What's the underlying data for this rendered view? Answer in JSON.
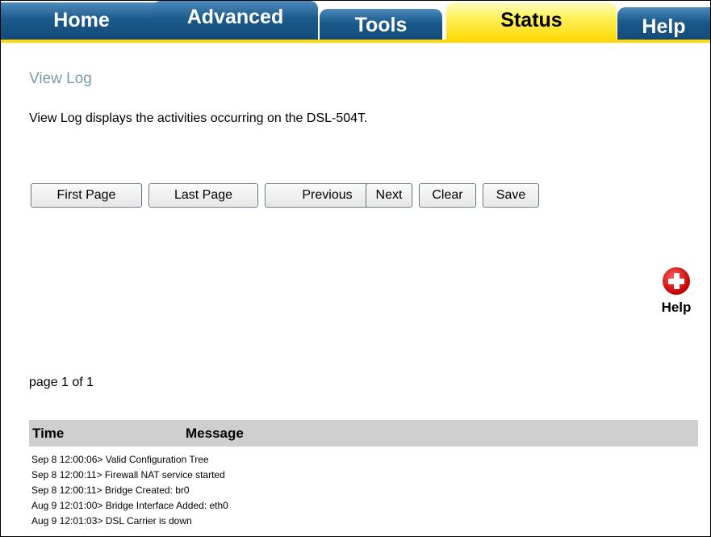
{
  "tabs": [
    {
      "label": "Home",
      "active": false
    },
    {
      "label": "Advanced",
      "active": false
    },
    {
      "label": "Tools",
      "active": false
    },
    {
      "label": "Status",
      "active": true
    },
    {
      "label": "Help",
      "active": false
    }
  ],
  "colors": {
    "tab_blue": "#1c5a8c",
    "tab_active_yellow": "#ffd90a",
    "title_color": "#7a9aac",
    "header_gray": "#cfcfcf",
    "help_red": "#c00000"
  },
  "page": {
    "title": "View Log",
    "description": "View Log displays the activities occurring on the DSL-504T."
  },
  "buttons": {
    "first": "First Page",
    "last": "Last Page",
    "previous": "Previous",
    "next": "Next",
    "clear": "Clear",
    "save": "Save"
  },
  "help": {
    "label": "Help",
    "icon": "plus-circle-icon"
  },
  "pagination": {
    "text": "page 1 of 1"
  },
  "log": {
    "columns": {
      "time": "Time",
      "message": "Message"
    },
    "entries": [
      "Sep 8 12:00:06> Valid Configuration Tree",
      "Sep 8 12:00:11> Firewall NAT service started",
      "Sep 8 12:00:11> Bridge Created: br0",
      "Aug 9 12:01:00> Bridge Interface Added: eth0",
      "Aug 9 12:01:03> DSL Carrier is down"
    ]
  }
}
